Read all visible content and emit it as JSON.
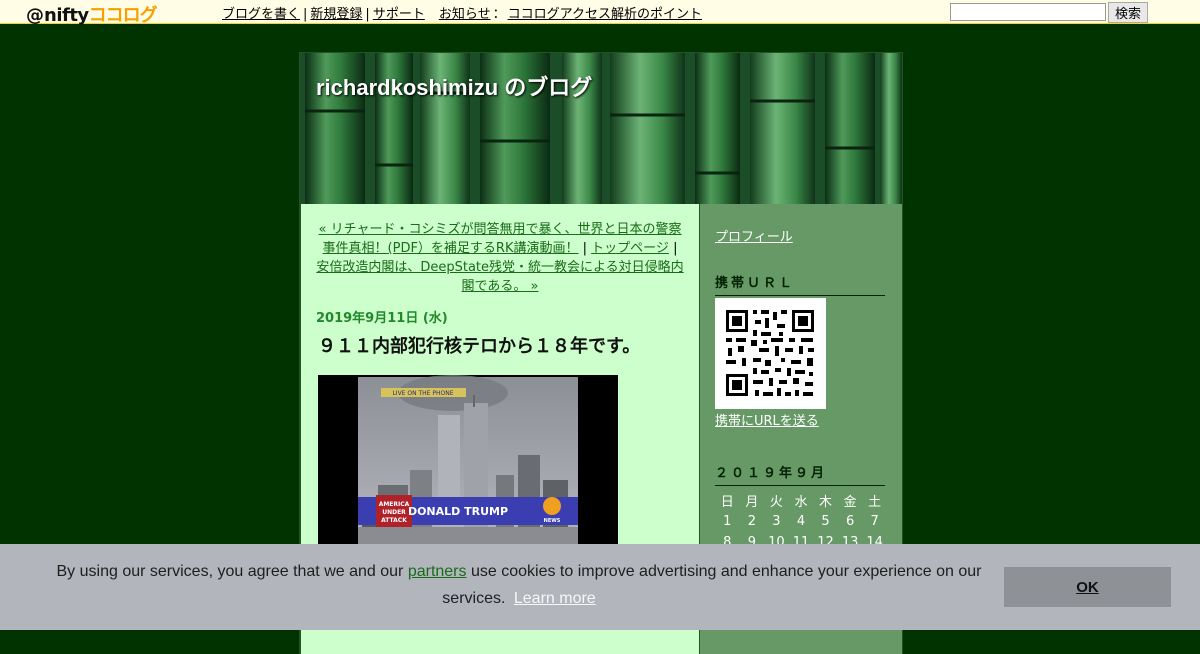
{
  "topbar": {
    "logo_at": "@",
    "logo_nifty": "nifty",
    "logo_coco": "ココログ",
    "links": [
      "ブログを書く",
      "新規登録",
      "サポート"
    ],
    "notice_label": "お知らせ",
    "notice_sep": "：",
    "notice_link": "ココログアクセス解析のポイント",
    "search_value": "",
    "search_button": "検索"
  },
  "blog": {
    "title": "richardkoshimizu のブログ"
  },
  "post": {
    "nav_prev": "« リチャード・コシミズが問答無用で暴く、世界と日本の警察事件真相！(PDF）を補足するRK講演動画！",
    "nav_sep1": "|",
    "nav_top": "トップページ",
    "nav_sep2": "|",
    "nav_next": "安倍改造内閣は、DeepState残党・統一教会による対日侵略内閣である。 »",
    "date": "2019年9月11日 (水)",
    "title": "９１１内部犯行核テロから１８年です。",
    "image_caption_top": "LIVE ON THE PHONE",
    "image_name": "DONALD TRUMP",
    "image_badge": "AMERICA UNDER ATTACK",
    "image_logo": "NEWS"
  },
  "sidebar": {
    "profile_link": "プロフィール",
    "mobile_heading": "携帯ＵＲＬ",
    "mobile_send_link": "携帯にURLを送る",
    "calendar_heading": "２０１９年９月",
    "weekdays": [
      "日",
      "月",
      "火",
      "水",
      "木",
      "金",
      "土"
    ],
    "weeks": [
      [
        "1",
        "2",
        "3",
        "4",
        "5",
        "6",
        "7"
      ],
      [
        "8",
        "9",
        "10",
        "11",
        "12",
        "13",
        "14"
      ]
    ]
  },
  "cookie": {
    "text_before": "By using our services, you agree that we and our",
    "partners_link": "partners",
    "text_after": "use cookies to improve advertising and enhance your experience on our services.",
    "learn_more": "Learn more",
    "ok_button": "OK"
  },
  "colors": {
    "page_bg": "#003300",
    "main_bg": "#ccffcc",
    "sidebar_bg": "#669966",
    "date_green": "#22882a",
    "cookie_bg": "#b2b6bc"
  }
}
